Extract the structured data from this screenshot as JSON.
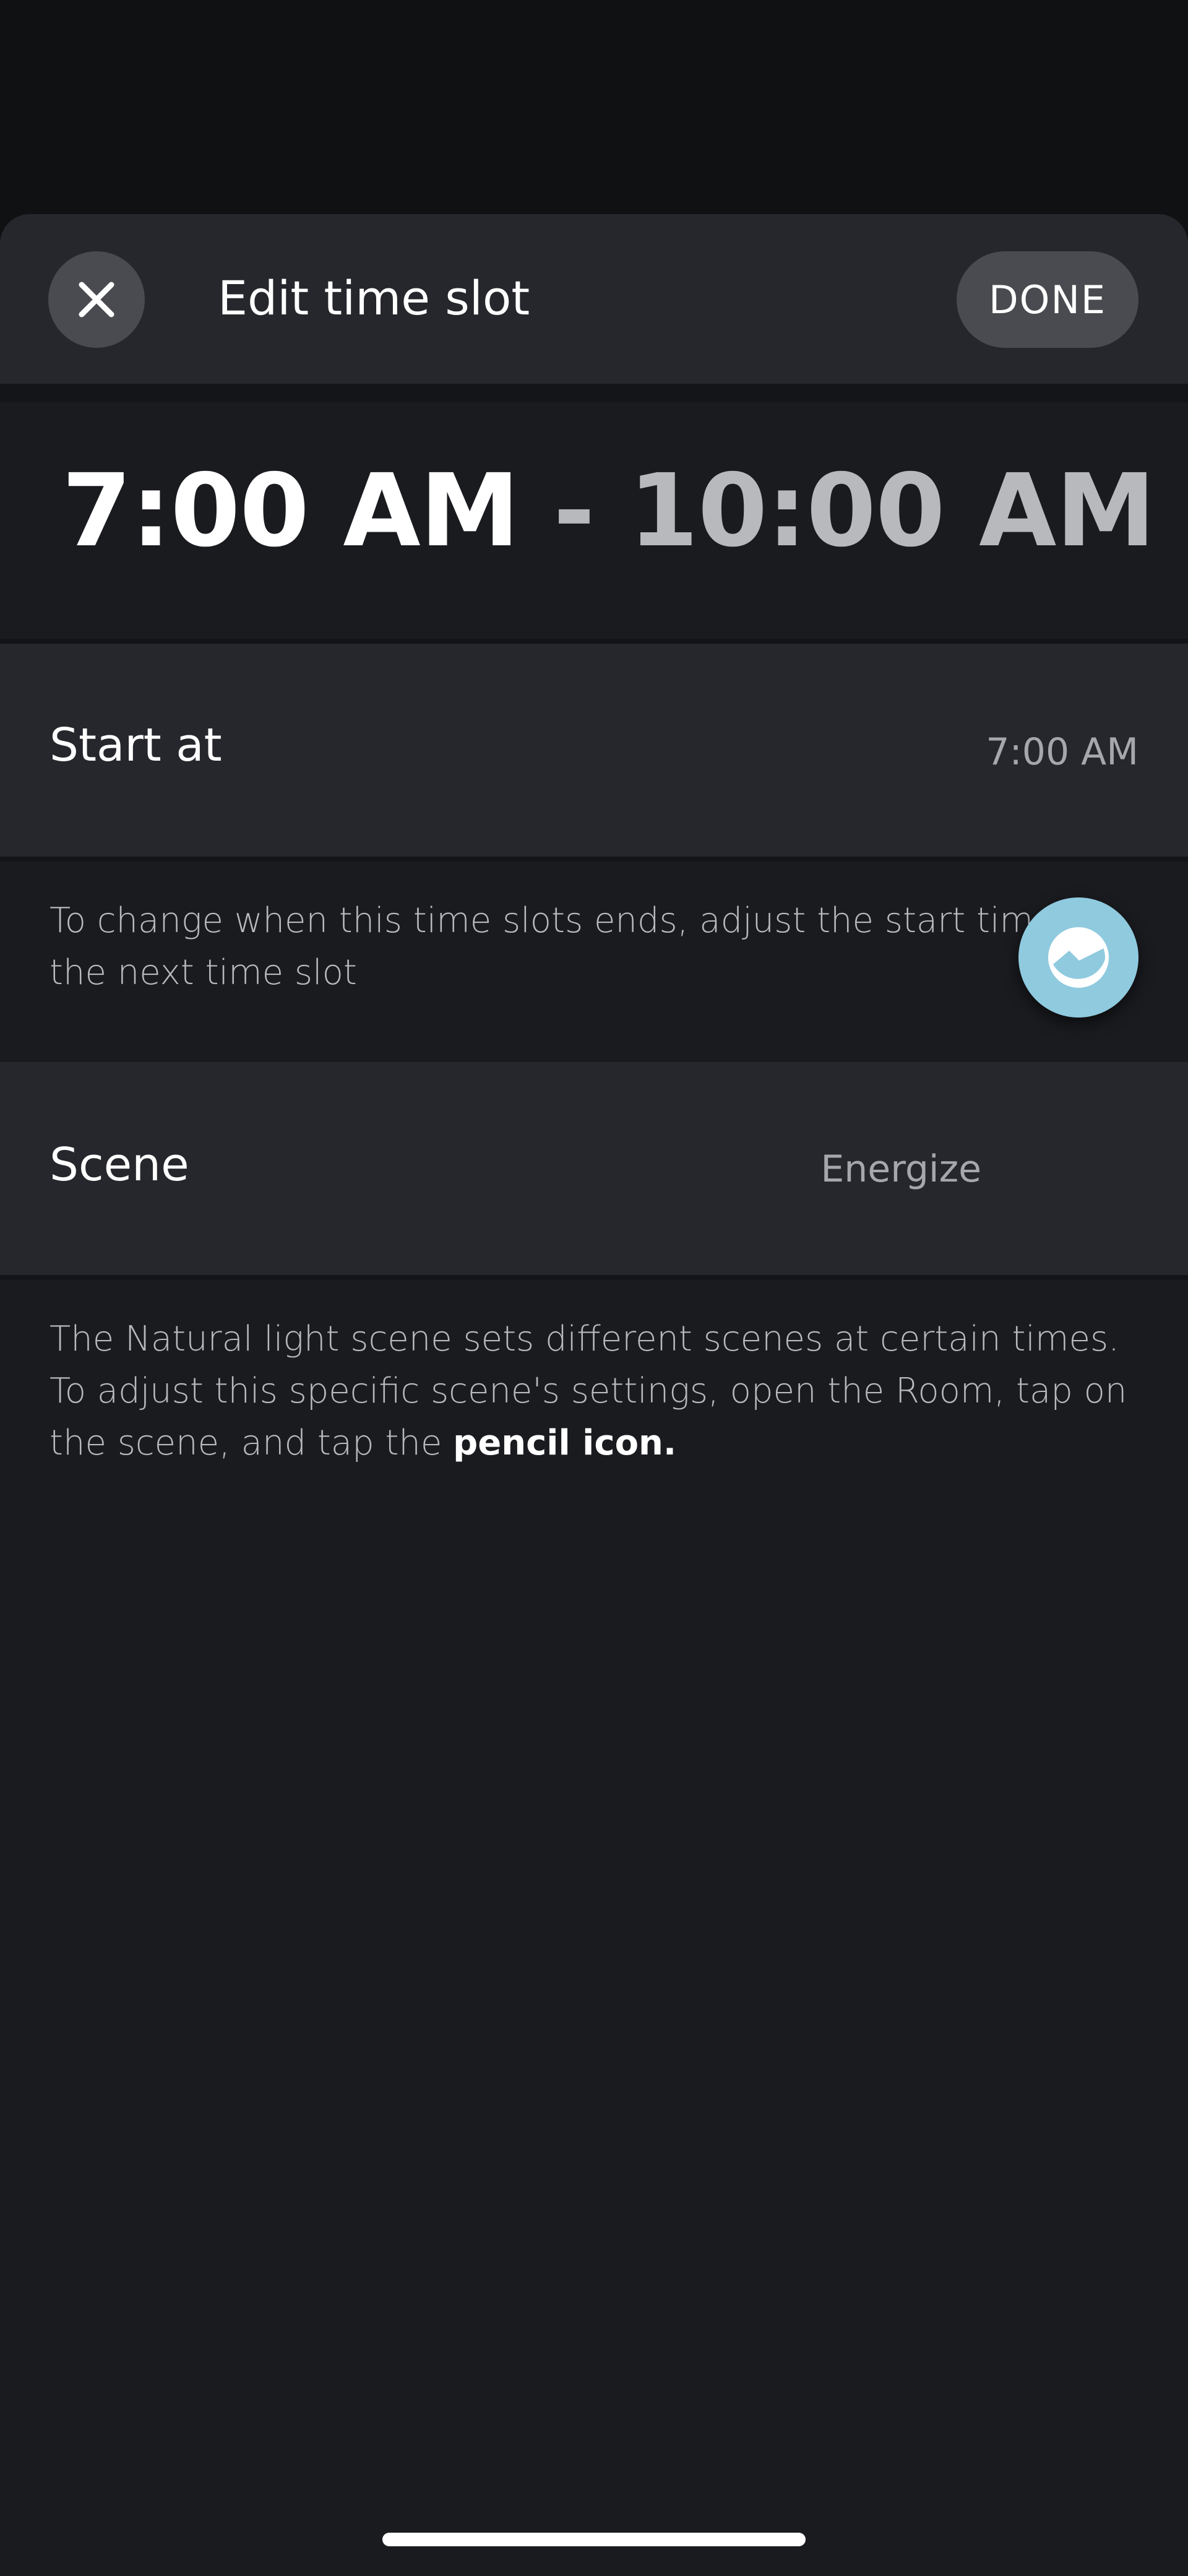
{
  "header": {
    "title": "Edit time slot",
    "done_label": "DONE",
    "close_icon": "close-icon"
  },
  "time_range": {
    "start": "7:00 AM",
    "separator": "-",
    "end": "10:00 AM"
  },
  "start_row": {
    "label": "Start at",
    "value": "7:00 AM"
  },
  "start_info": "To change when this time slots ends, adjust the start time of the next time slot",
  "scene_row": {
    "label": "Scene",
    "value": "Energize",
    "icon": "scene-energize-icon",
    "icon_color": "#8fcadf"
  },
  "scene_info": {
    "text": "The Natural light scene sets different scenes at certain times. To adjust this specific scene's settings, open the Room, tap on the scene, and tap the ",
    "emphasis": "pencil icon."
  },
  "colors": {
    "background": "#1a1b1f",
    "card": "#26272c",
    "button": "#4a4b50",
    "muted_text": "#b8b9bd"
  }
}
